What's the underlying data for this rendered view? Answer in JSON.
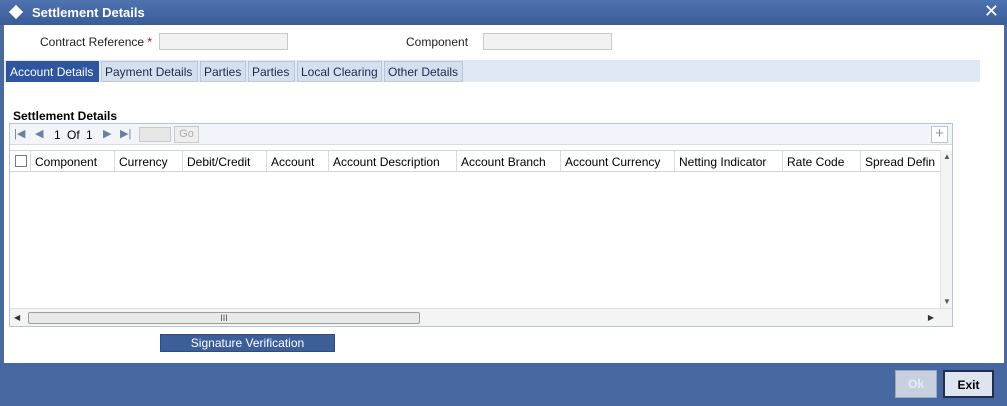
{
  "window": {
    "title": "Settlement Details",
    "close_glyph": "✕"
  },
  "header": {
    "contract_reference_label": "Contract Reference",
    "required_mark": "*",
    "contract_reference_value": "",
    "component_label": "Component",
    "component_value": ""
  },
  "tabs": [
    {
      "label": "Account Details",
      "active": true
    },
    {
      "label": "Payment Details"
    },
    {
      "label": "Parties"
    },
    {
      "label": "Parties"
    },
    {
      "label": "Local Clearing"
    },
    {
      "label": "Other Details"
    }
  ],
  "section": {
    "title": "Settlement Details"
  },
  "pager": {
    "current": "1",
    "of_label": "Of",
    "total": "1",
    "go_label": "Go",
    "add_glyph": "+"
  },
  "grid": {
    "columns": [
      "Component",
      "Currency",
      "Debit/Credit",
      "Account",
      "Account Description",
      "Account Branch",
      "Account Currency",
      "Netting Indicator",
      "Rate Code",
      "Spread Defin"
    ],
    "rows": []
  },
  "scroll": {
    "thumb_grip": "III"
  },
  "buttons": {
    "signature_verification": "Signature Verification",
    "ok": "Ok",
    "exit": "Exit"
  },
  "colors": {
    "accent": "#2f55a0",
    "titlebar": "#3a5c98",
    "footer": "#46679f"
  }
}
